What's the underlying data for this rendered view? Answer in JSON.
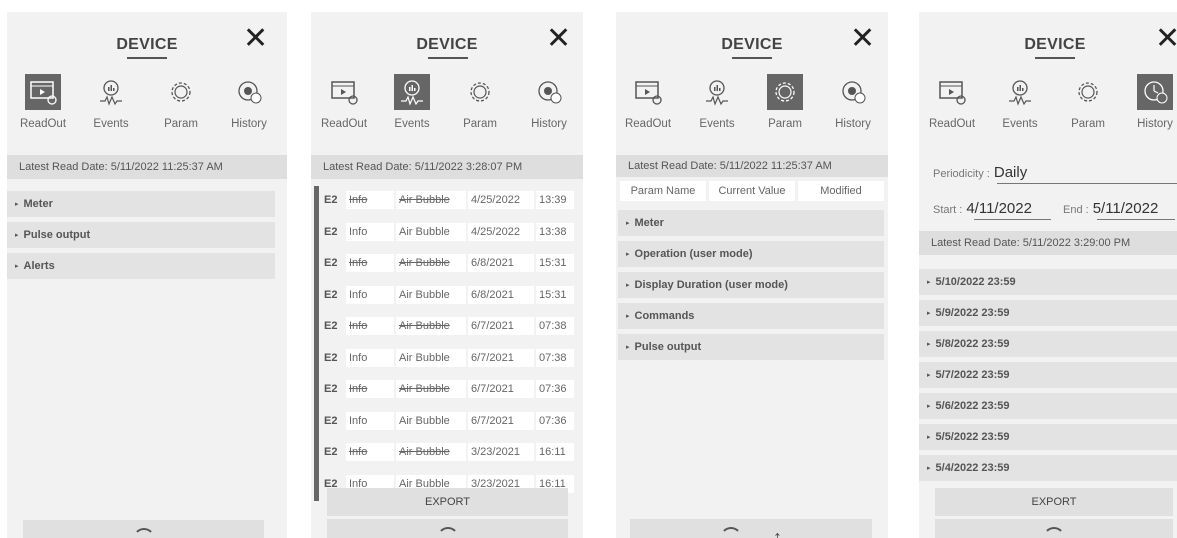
{
  "title": "DEVICE",
  "nav": [
    {
      "label": "ReadOut",
      "icon": "readout-icon"
    },
    {
      "label": "Events",
      "icon": "events-icon"
    },
    {
      "label": "Param",
      "icon": "param-icon"
    },
    {
      "label": "History",
      "icon": "history-icon"
    }
  ],
  "readout": {
    "latest": "Latest Read Date: 5/11/2022 11:25:37 AM",
    "sections": [
      "Meter",
      "Pulse output",
      "Alerts"
    ]
  },
  "events": {
    "latest": "Latest Read Date: 5/11/2022 3:28:07 PM",
    "rows": [
      {
        "code": "E2",
        "level": "Info",
        "message": "Air Bubble",
        "date": "4/25/2022",
        "time": "13:39",
        "struck": true
      },
      {
        "code": "E2",
        "level": "Info",
        "message": "Air Bubble",
        "date": "4/25/2022",
        "time": "13:38",
        "struck": false
      },
      {
        "code": "E2",
        "level": "Info",
        "message": "Air Bubble",
        "date": "6/8/2021",
        "time": "15:31",
        "struck": true
      },
      {
        "code": "E2",
        "level": "Info",
        "message": "Air Bubble",
        "date": "6/8/2021",
        "time": "15:31",
        "struck": false
      },
      {
        "code": "E2",
        "level": "Info",
        "message": "Air Bubble",
        "date": "6/7/2021",
        "time": "07:38",
        "struck": true
      },
      {
        "code": "E2",
        "level": "Info",
        "message": "Air Bubble",
        "date": "6/7/2021",
        "time": "07:38",
        "struck": false
      },
      {
        "code": "E2",
        "level": "Info",
        "message": "Air Bubble",
        "date": "6/7/2021",
        "time": "07:36",
        "struck": true
      },
      {
        "code": "E2",
        "level": "Info",
        "message": "Air Bubble",
        "date": "6/7/2021",
        "time": "07:36",
        "struck": false
      },
      {
        "code": "E2",
        "level": "Info",
        "message": "Air Bubble",
        "date": "3/23/2021",
        "time": "16:11",
        "struck": true
      },
      {
        "code": "E2",
        "level": "Info",
        "message": "Air Bubble",
        "date": "3/23/2021",
        "time": "16:11",
        "struck": false
      }
    ],
    "export_label": "EXPORT"
  },
  "param": {
    "latest": "Latest Read Date: 5/11/2022 11:25:37 AM",
    "columns": [
      "Param Name",
      "Current Value",
      "Modified"
    ],
    "sections": [
      "Meter",
      "Operation (user mode)",
      "Display Duration (user mode)",
      "Commands",
      "Pulse output"
    ]
  },
  "history": {
    "periodicity_label": "Periodicity :",
    "periodicity_value": "Daily",
    "start_label": "Start :",
    "start_value": "4/11/2022",
    "end_label": "End :",
    "end_value": "5/11/2022",
    "latest": "Latest Read Date: 5/11/2022 3:29:00 PM",
    "entries": [
      "5/10/2022 23:59",
      "5/9/2022 23:59",
      "5/8/2022 23:59",
      "5/7/2022 23:59",
      "5/6/2022 23:59",
      "5/5/2022 23:59",
      "5/4/2022 23:59"
    ],
    "export_label": "EXPORT"
  },
  "active_tabs": [
    "ReadOut",
    "Events",
    "Param",
    "History"
  ]
}
